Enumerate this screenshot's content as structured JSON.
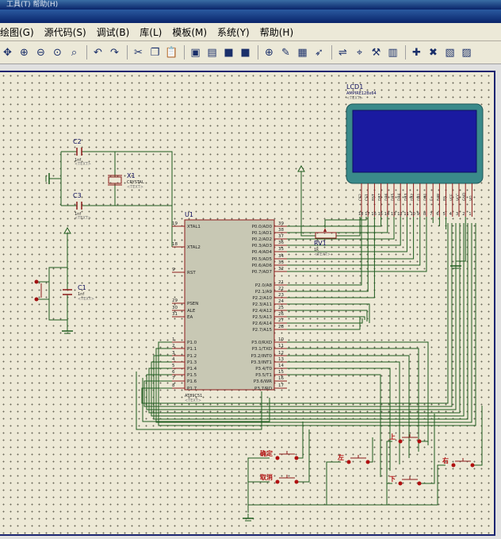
{
  "window": {
    "title_fragment": "工具(T)   帮助(H)"
  },
  "menu": [
    {
      "label": "绘图(G)"
    },
    {
      "label": "源代码(S)"
    },
    {
      "label": "调试(B)"
    },
    {
      "label": "库(L)"
    },
    {
      "label": "模板(M)"
    },
    {
      "label": "系统(Y)"
    },
    {
      "label": "帮助(H)"
    }
  ],
  "toolbar": [
    "pan-icon",
    "zoom-in-icon",
    "zoom-out-icon",
    "zoom-all-icon",
    "zoom-area-icon",
    "undo-icon",
    "redo-icon",
    "cut-icon",
    "copy-icon",
    "paste-icon",
    "block-copy-icon",
    "block-move-icon",
    "block-rotate-icon",
    "block-delete-icon",
    "pick-device-icon",
    "make-device-icon",
    "package-tool-icon",
    "decompose-icon",
    "wire-autoroute-icon",
    "search-icon",
    "property-tool-icon",
    "design-explorer-icon",
    "new-sheet-icon",
    "remove-sheet-icon",
    "netlist-icon",
    "bom-icon"
  ],
  "schematic": {
    "lcd": {
      "ref": "LCD1",
      "part": "AMPIRE128x64",
      "text": "<TEXT>",
      "pins": [
        "CS2",
        "CS1",
        "RST",
        "DB7",
        "DB6",
        "DB5",
        "DB4",
        "DB3",
        "DB2",
        "DB1",
        "DB0",
        "E",
        "R/W",
        "RS",
        "VEE",
        "VCC",
        "GND",
        "VO"
      ],
      "pin_numbers": [
        "18",
        "17",
        "16",
        "15",
        "14",
        "13",
        "12",
        "11",
        "10",
        "9",
        "8",
        "7",
        "6",
        "5",
        "4",
        "3",
        "2",
        "1"
      ]
    },
    "mcu": {
      "ref": "U1",
      "part": "AT89C51",
      "text": "<TEXT>",
      "left_pins": [
        {
          "num": "19",
          "name": "XTAL1"
        },
        {
          "num": "18",
          "name": "XTAL2"
        },
        {
          "num": "9",
          "name": "RST"
        },
        {
          "num": "29",
          "name": "PSEN"
        },
        {
          "num": "30",
          "name": "ALE"
        },
        {
          "num": "31",
          "name": "EA"
        },
        {
          "num": "1",
          "name": "P1.0"
        },
        {
          "num": "2",
          "name": "P1.1"
        },
        {
          "num": "3",
          "name": "P1.2"
        },
        {
          "num": "4",
          "name": "P1.3"
        },
        {
          "num": "5",
          "name": "P1.4"
        },
        {
          "num": "6",
          "name": "P1.5"
        },
        {
          "num": "7",
          "name": "P1.6"
        },
        {
          "num": "8",
          "name": "P1.7"
        }
      ],
      "right_pins": [
        {
          "num": "39",
          "name": "P0.0/AD0"
        },
        {
          "num": "38",
          "name": "P0.1/AD1"
        },
        {
          "num": "37",
          "name": "P0.2/AD2"
        },
        {
          "num": "36",
          "name": "P0.3/AD3"
        },
        {
          "num": "35",
          "name": "P0.4/AD4"
        },
        {
          "num": "34",
          "name": "P0.5/AD5"
        },
        {
          "num": "33",
          "name": "P0.6/AD6"
        },
        {
          "num": "32",
          "name": "P0.7/AD7"
        },
        {
          "num": "21",
          "name": "P2.0/A8"
        },
        {
          "num": "22",
          "name": "P2.1/A9"
        },
        {
          "num": "23",
          "name": "P2.2/A10"
        },
        {
          "num": "24",
          "name": "P2.3/A11"
        },
        {
          "num": "25",
          "name": "P2.4/A12"
        },
        {
          "num": "26",
          "name": "P2.5/A13"
        },
        {
          "num": "27",
          "name": "P2.6/A14"
        },
        {
          "num": "28",
          "name": "P2.7/A15"
        },
        {
          "num": "10",
          "name": "P3.0/RXD"
        },
        {
          "num": "11",
          "name": "P3.1/TXD"
        },
        {
          "num": "12",
          "name": "P3.2/INT0"
        },
        {
          "num": "13",
          "name": "P3.3/INT1"
        },
        {
          "num": "14",
          "name": "P3.4/T0"
        },
        {
          "num": "15",
          "name": "P3.5/T1"
        },
        {
          "num": "16",
          "name": "P3.6/WR"
        },
        {
          "num": "17",
          "name": "P3.7/RD"
        }
      ]
    },
    "c2": {
      "ref": "C2",
      "value": "1nf",
      "text": "<TEXT>"
    },
    "c3": {
      "ref": "C3",
      "value": "1nf",
      "text": "<TEXT>"
    },
    "c1": {
      "ref": "C1",
      "value": "1nf",
      "text": "<TEXT>"
    },
    "x1": {
      "ref": "X1",
      "value": "CRYSTAL",
      "text": "<TEXT>"
    },
    "rv1": {
      "ref": "RV1",
      "value": "1k",
      "text": "<TEXT>"
    },
    "buttons": [
      {
        "label": "确定"
      },
      {
        "label": "取消"
      },
      {
        "label": "上"
      },
      {
        "label": "左"
      },
      {
        "label": "下"
      },
      {
        "label": "右"
      }
    ]
  },
  "colors": {
    "wire": "#1f5c1f",
    "component": "#8b1a1a",
    "text": "#0a0a5a",
    "lcd_bezel": "#3a8a8a",
    "lcd_screen": "#1a1aa0",
    "chip_fill": "#c8c8b4"
  }
}
